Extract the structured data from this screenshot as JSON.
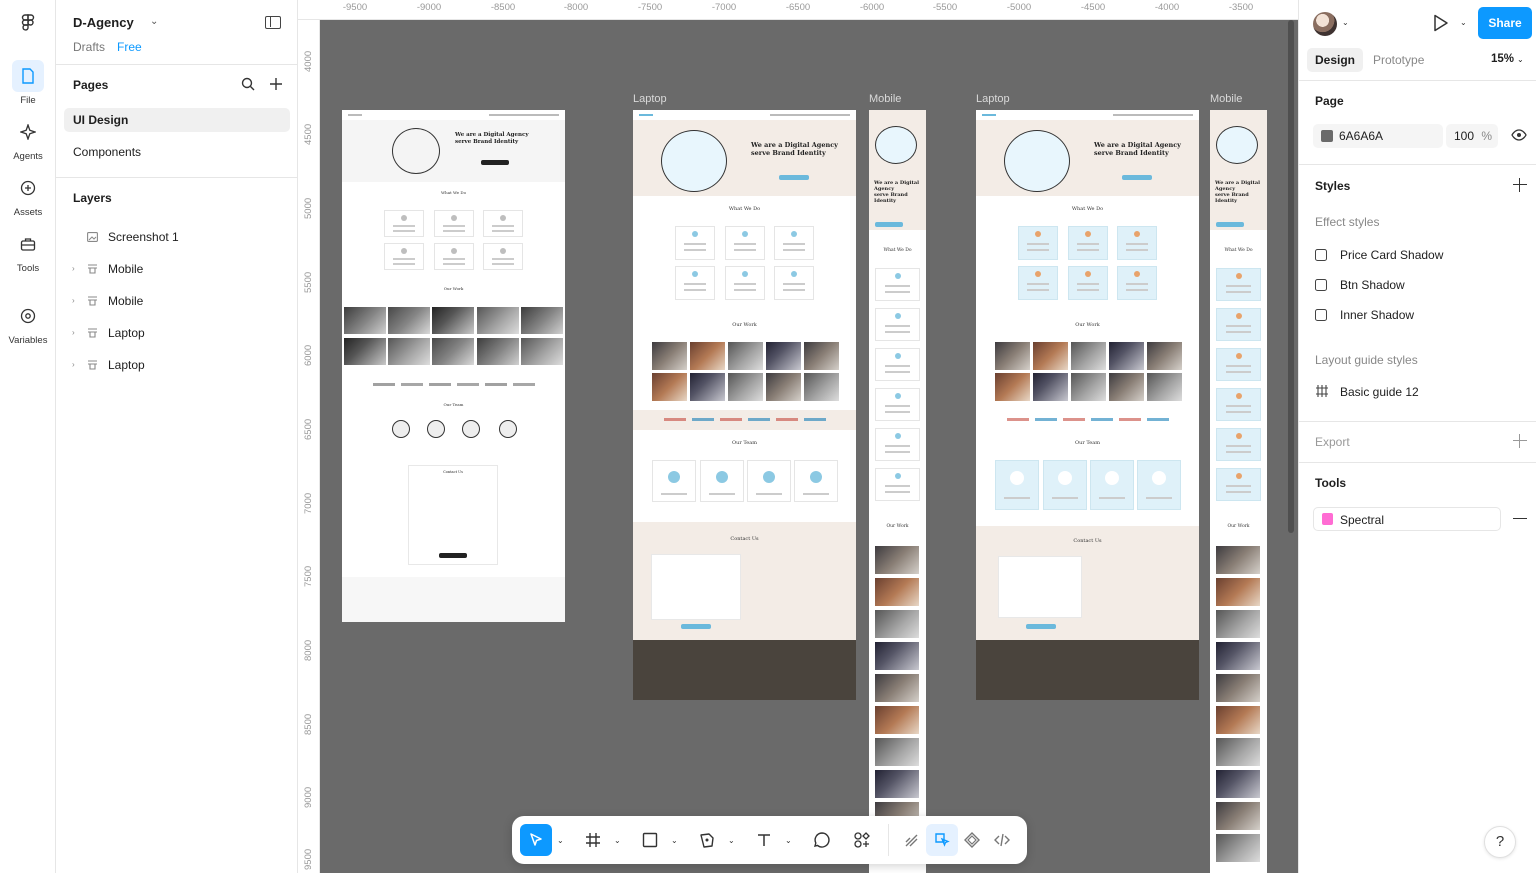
{
  "project": {
    "title": "D-Agency",
    "location": "Drafts",
    "plan": "Free"
  },
  "rail": [
    {
      "label": "File",
      "icon": "file-icon",
      "active": true
    },
    {
      "label": "Agents",
      "icon": "agents-icon",
      "active": false
    },
    {
      "label": "Assets",
      "icon": "assets-icon",
      "active": false
    },
    {
      "label": "Tools",
      "icon": "tools-icon",
      "active": false
    },
    {
      "label": "Variables",
      "icon": "variables-icon",
      "active": false
    }
  ],
  "pages": {
    "title": "Pages",
    "items": [
      {
        "label": "UI Design",
        "selected": true
      },
      {
        "label": "Components",
        "selected": false
      }
    ]
  },
  "layers": {
    "title": "Layers",
    "items": [
      {
        "label": "Screenshot 1",
        "type": "image"
      },
      {
        "label": "Mobile",
        "type": "frame"
      },
      {
        "label": "Mobile",
        "type": "frame"
      },
      {
        "label": "Laptop",
        "type": "frame"
      },
      {
        "label": "Laptop",
        "type": "frame"
      }
    ]
  },
  "rulers": {
    "x": [
      "-9500",
      "-9000",
      "-8500",
      "-8000",
      "-7500",
      "-7000",
      "-6500",
      "-6000",
      "-5500",
      "-5000",
      "-4500",
      "-4000",
      "-3500"
    ],
    "y": [
      "4000",
      "4500",
      "5000",
      "5500",
      "6000",
      "6500",
      "7000",
      "7500",
      "8000",
      "8500",
      "9000",
      "9500"
    ]
  },
  "canvas": {
    "background": "#6a6a6a",
    "frame_labels": [
      "Laptop",
      "Mobile",
      "Laptop",
      "Mobile"
    ],
    "mock": {
      "hero_title_1": "We are a Digital Agency",
      "hero_title_2": "serve Brand Identity",
      "what_we_do": "What We Do",
      "our_work": "Our Work",
      "our_team": "Our Team",
      "contact": "Contact Us"
    }
  },
  "toolbar": {
    "tools": [
      "move-tool",
      "frame-tool",
      "shape-tool",
      "pen-tool",
      "text-tool",
      "comment-tool",
      "actions-tool"
    ],
    "modes": [
      "draw-mode",
      "design-mode",
      "prototype-mode",
      "dev-mode"
    ]
  },
  "right": {
    "share_label": "Share",
    "tabs": [
      {
        "label": "Design",
        "active": true
      },
      {
        "label": "Prototype",
        "active": false
      }
    ],
    "zoom": "15%",
    "page": {
      "title": "Page",
      "color_hex": "6A6A6A",
      "opacity": "100",
      "percent": "%"
    },
    "styles": {
      "title": "Styles",
      "effect_title": "Effect styles",
      "effects": [
        "Price Card Shadow",
        "Btn Shadow",
        "Inner Shadow"
      ],
      "layout_title": "Layout guide styles",
      "layout": [
        "Basic guide 12"
      ]
    },
    "export_title": "Export",
    "tools_title": "Tools",
    "plugin": "Spectral",
    "help": "?"
  },
  "colors": {
    "accent": "#0d99ff",
    "canvas": "#6a6a6a",
    "footer": "#4a443d",
    "highlight": "#dff1f9"
  }
}
